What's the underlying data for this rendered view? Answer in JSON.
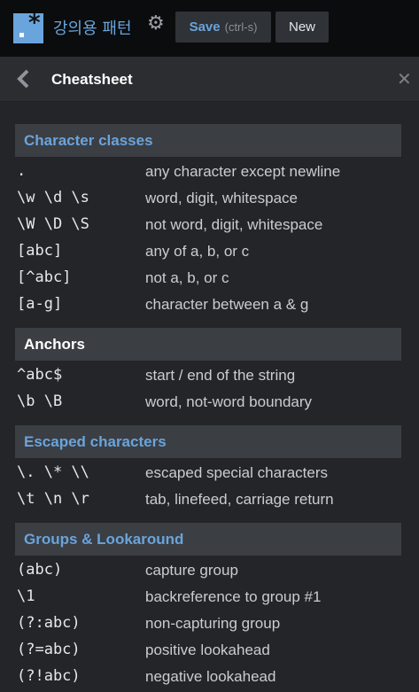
{
  "app": {
    "title": "강의용 패턴",
    "save_label": "Save",
    "save_hint": "(ctrl-s)",
    "new_label": "New"
  },
  "cheatsheet": {
    "title": "Cheatsheet"
  },
  "colors": {
    "accent": "#6aa4dc",
    "section_white": "#ffffff"
  },
  "sections": [
    {
      "title": "Character classes",
      "title_color": "#6aa4dc",
      "rows": [
        {
          "token": ".",
          "desc": "any character except newline"
        },
        {
          "token": "\\w \\d \\s",
          "desc": "word, digit, whitespace"
        },
        {
          "token": "\\W \\D \\S",
          "desc": "not word, digit, whitespace"
        },
        {
          "token": "[abc]",
          "desc": "any of a, b, or c"
        },
        {
          "token": "[^abc]",
          "desc": "not a, b, or c"
        },
        {
          "token": "[a-g]",
          "desc": "character between a & g"
        }
      ]
    },
    {
      "title": "Anchors",
      "title_color": "#ffffff",
      "rows": [
        {
          "token": "^abc$",
          "desc": "start / end of the string"
        },
        {
          "token": "\\b \\B",
          "desc": "word, not-word boundary"
        }
      ]
    },
    {
      "title": "Escaped characters",
      "title_color": "#6aa4dc",
      "rows": [
        {
          "token": "\\. \\* \\\\",
          "desc": "escaped special characters"
        },
        {
          "token": "\\t \\n \\r",
          "desc": "tab, linefeed, carriage return"
        }
      ]
    },
    {
      "title": "Groups & Lookaround",
      "title_color": "#6aa4dc",
      "rows": [
        {
          "token": "(abc)",
          "desc": "capture group"
        },
        {
          "token": "\\1",
          "desc": "backreference to group #1"
        },
        {
          "token": "(?:abc)",
          "desc": "non-capturing group"
        },
        {
          "token": "(?=abc)",
          "desc": "positive lookahead"
        },
        {
          "token": "(?!abc)",
          "desc": "negative lookahead"
        }
      ]
    }
  ]
}
